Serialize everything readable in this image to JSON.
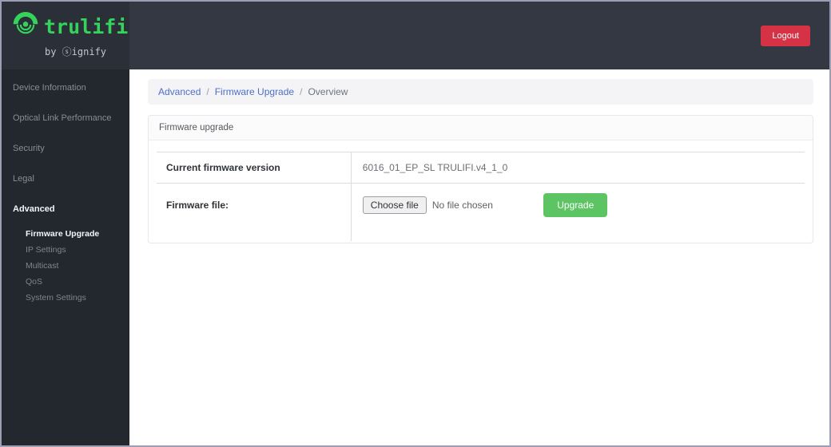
{
  "brand": {
    "name": "trulifi",
    "byline": "by ⓢignify"
  },
  "header": {
    "logout": "Logout"
  },
  "sidebar": {
    "items": [
      {
        "label": "Device Information"
      },
      {
        "label": "Optical Link Performance"
      },
      {
        "label": "Security"
      },
      {
        "label": "Legal"
      },
      {
        "label": "Advanced"
      }
    ],
    "advanced_sub_items": [
      {
        "label": "Firmware Upgrade"
      },
      {
        "label": "IP Settings"
      },
      {
        "label": "Multicast"
      },
      {
        "label": "QoS"
      },
      {
        "label": "System Settings"
      }
    ]
  },
  "breadcrumb": {
    "link1": "Advanced",
    "separator": "/",
    "link2": "Firmware Upgrade",
    "current": "Overview"
  },
  "panel": {
    "title": "Firmware upgrade",
    "firmware_version_row": {
      "label": "Current firmware version",
      "value": "6016_01_EP_SL TRULIFI.v4_1_0"
    },
    "firmware_file_row": {
      "label": "Firmware file:",
      "choose_file_button": "Choose file",
      "file_status": "No file chosen",
      "upgrade_button": "Upgrade"
    }
  },
  "colors": {
    "accent_green": "#34d45c",
    "logout_red": "#d53345",
    "upgrade_green": "#5cc463",
    "link_blue": "#4d6fc9",
    "header_bg": "#333842",
    "sidebar_bg": "#23272e"
  }
}
